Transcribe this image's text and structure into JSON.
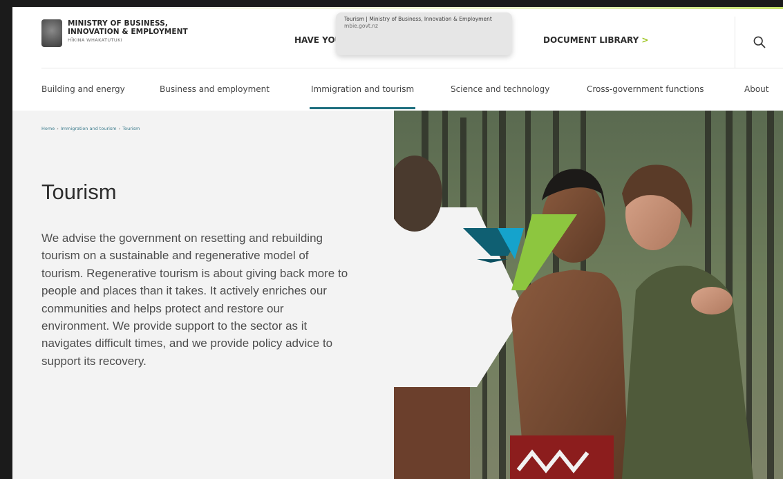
{
  "header": {
    "logo": {
      "line1": "MINISTRY OF BUSINESS,",
      "line2": "INNOVATION & EMPLOYMENT",
      "line3": "HĪKINA WHAKATUTUKI"
    },
    "nav_have": "HAVE YOU",
    "nav_document_library": "DOCUMENT LIBRARY",
    "doclib_chevron": ">",
    "search_icon": "search-icon"
  },
  "tooltip": {
    "title": "Tourism | Ministry of Business, Innovation & Employment",
    "url": "mbie.govt.nz"
  },
  "subnav": {
    "items": [
      {
        "label": "Building and energy"
      },
      {
        "label": "Business and employment"
      },
      {
        "label": "Immigration and tourism",
        "active": true
      },
      {
        "label": "Science and technology"
      },
      {
        "label": "Cross-government functions"
      },
      {
        "label": "About"
      }
    ]
  },
  "breadcrumb": {
    "home": "Home",
    "sep": "›",
    "level1": "Immigration and tourism",
    "current": "Tourism"
  },
  "hero": {
    "title": "Tourism",
    "description": "We advise the government on resetting and rebuilding tourism on a sustainable and regenerative model of tourism. Regenerative tourism is about giving back more to people and places than it takes. It actively enriches our communities and helps protect and restore our environment. We provide support to the sector as it navigates difficult times, and we provide policy advice to support its recovery."
  },
  "colors": {
    "accent_teal": "#1d6f7f",
    "accent_lime": "#9bc31a",
    "brand_dark_teal": "#0f6b80",
    "brand_light_blue": "#17a4d0"
  }
}
